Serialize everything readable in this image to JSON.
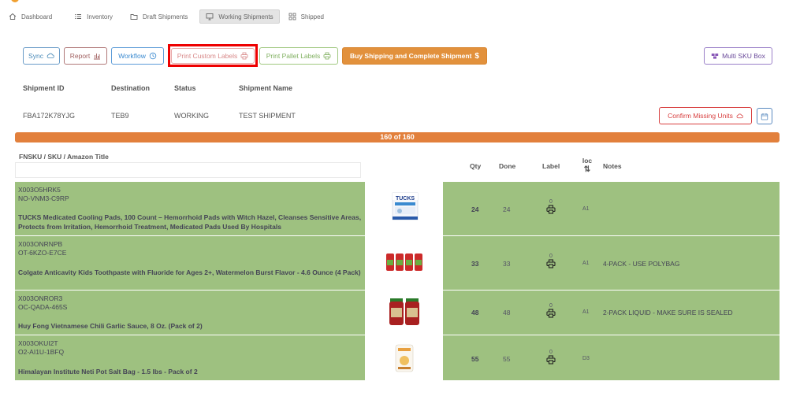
{
  "nav": {
    "items": [
      {
        "label": "Dashboard",
        "icon": "home-icon"
      },
      {
        "label": "Inventory",
        "icon": "list-icon"
      },
      {
        "label": "Draft Shipments",
        "icon": "folder-icon"
      },
      {
        "label": "Working Shipments",
        "icon": "monitor-icon",
        "active": true
      },
      {
        "label": "Shipped",
        "icon": "grid-icon"
      }
    ]
  },
  "toolbar": {
    "sync": "Sync",
    "report": "Report",
    "workflow": "Workflow",
    "print_custom": "Print Custom Labels",
    "print_pallet": "Print Pallet Labels",
    "buy_shipping": "Buy Shipping and Complete Shipment",
    "multi_sku": "Multi SKU Box"
  },
  "shipment": {
    "headers": {
      "id": "Shipment ID",
      "destination": "Destination",
      "status": "Status",
      "name": "Shipment Name"
    },
    "id": "FBA172K78YJG",
    "destination": "TEB9",
    "status": "WORKING",
    "name": "TEST SHIPMENT",
    "confirm_button": "Confirm Missing Units"
  },
  "progress": {
    "label": "160 of 160",
    "done": 160,
    "total": 160
  },
  "table": {
    "headers": {
      "product": "FNSKU / SKU / Amazon Title",
      "qty": "Qty",
      "done": "Done",
      "label": "Label",
      "loc": "loc",
      "loc_sort": "⇅",
      "notes": "Notes"
    },
    "rows": [
      {
        "fnsku": "X003O5HRK5",
        "sku": "NO-VNM3-C9RP",
        "title": "TUCKS Medicated Cooling Pads, 100 Count – Hemorrhoid Pads with Witch Hazel, Cleanses Sensitive Areas, Protects from Irritation, Hemorrhoid Treatment, Medicated Pads Used By Hospitals",
        "qty": "24",
        "done": "24",
        "label_count": "0",
        "loc": "A1",
        "note": ""
      },
      {
        "fnsku": "X003ONRNPB",
        "sku": "OT-6KZO-E7CE",
        "title": "Colgate Anticavity Kids Toothpaste with Fluoride for Ages 2+, Watermelon Burst Flavor - 4.6 Ounce (4 Pack)",
        "qty": "33",
        "done": "33",
        "label_count": "0",
        "loc": "A1",
        "note": "4-PACK - USE POLYBAG"
      },
      {
        "fnsku": "X003ONROR3",
        "sku": "OC-QADA-465S",
        "title": "Huy Fong Vietnamese Chili Garlic Sauce, 8 Oz. (Pack of 2)",
        "qty": "48",
        "done": "48",
        "label_count": "0",
        "loc": "A1",
        "note": "2-PACK LIQUID - MAKE SURE IS SEALED"
      },
      {
        "fnsku": "X003OKUI2T",
        "sku": "O2-AI1U-1BFQ",
        "title": "Himalayan Institute Neti Pot Salt Bag - 1.5 lbs - Pack of 2",
        "qty": "55",
        "done": "55",
        "label_count": "0",
        "loc": "D3",
        "note": ""
      }
    ]
  },
  "images": {
    "tucks_brand": "TUCKS"
  },
  "colors": {
    "accent": "#e2913c",
    "row_bg": "#9ec180",
    "highlight": "#ee0000"
  }
}
